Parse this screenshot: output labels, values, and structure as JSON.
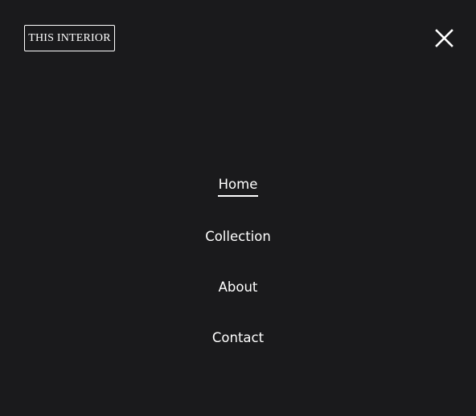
{
  "header": {
    "logo_text": "THIS INTERIOR",
    "close_icon": "close-icon"
  },
  "nav": {
    "items": [
      {
        "label": "Home",
        "active": true
      },
      {
        "label": "Collection",
        "active": false
      },
      {
        "label": "About",
        "active": false
      },
      {
        "label": "Contact",
        "active": false
      }
    ]
  },
  "colors": {
    "background": "#1a1a1c",
    "text": "#ffffff"
  }
}
